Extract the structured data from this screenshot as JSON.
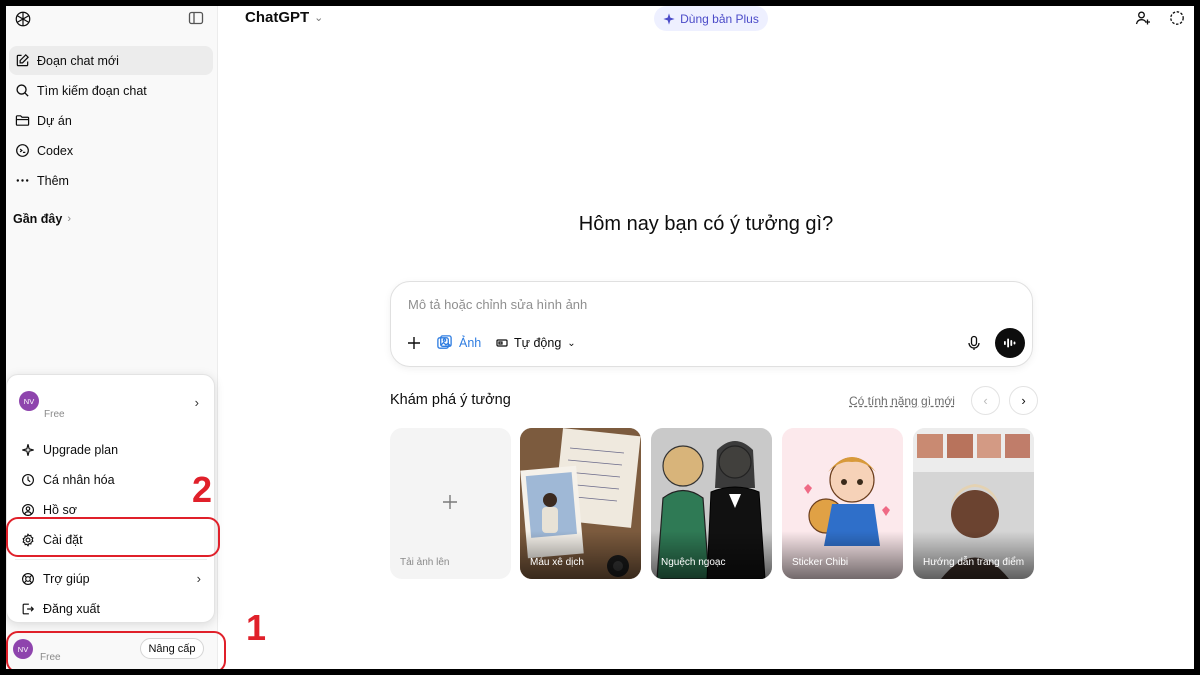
{
  "sidebar": {
    "nav": [
      {
        "label": "Đoạn chat mới",
        "icon": "edit-icon"
      },
      {
        "label": "Tìm kiếm đoạn chat",
        "icon": "search-icon"
      },
      {
        "label": "Dự án",
        "icon": "folder-icon"
      },
      {
        "label": "Codex",
        "icon": "codex-icon"
      },
      {
        "label": "Thêm",
        "icon": "more-icon"
      }
    ],
    "recent_label": "Gần đây",
    "recent_chevron": "›"
  },
  "popup": {
    "user_initials": "NV",
    "user_plan": "Free",
    "arrow": "›",
    "items": [
      {
        "label": "Upgrade plan",
        "icon": "sparkle-icon"
      },
      {
        "label": "Cá nhân hóa",
        "icon": "personalize-icon"
      },
      {
        "label": "Hồ sơ",
        "icon": "profile-icon"
      },
      {
        "label": "Cài đặt",
        "icon": "gear-icon"
      },
      {
        "label": "Trợ giúp",
        "icon": "help-icon"
      },
      {
        "label": "Đăng xuất",
        "icon": "logout-icon"
      }
    ]
  },
  "account": {
    "initials": "NV",
    "plan": "Free",
    "upgrade_label": "Nâng cấp"
  },
  "annotations": {
    "step1": "1",
    "step2": "2",
    "color": "#e0202a"
  },
  "header": {
    "model": "ChatGPT",
    "model_chevron": "⌄",
    "plus_label": "Dùng bản Plus"
  },
  "main": {
    "headline": "Hôm nay bạn có ý tưởng gì?",
    "composer": {
      "placeholder": "Mô tả hoặc chỉnh sửa hình ảnh",
      "image_label": "Ảnh",
      "mode_label": "Tự động",
      "mode_chevron": "⌄"
    },
    "explore": {
      "title": "Khám phá ý tưởng",
      "whats_new": "Có tính năng gì mới",
      "prev": "‹",
      "next": "›",
      "cards": [
        "Tải ảnh lên",
        "Máu xê dịch",
        "Nguệch ngoạc",
        "Sticker Chibi",
        "Hướng dẫn trang điểm"
      ]
    }
  },
  "colors": {
    "accent": "#2f7de1",
    "plus_text": "#4b4bc8",
    "avatar": "#8e44ad"
  }
}
